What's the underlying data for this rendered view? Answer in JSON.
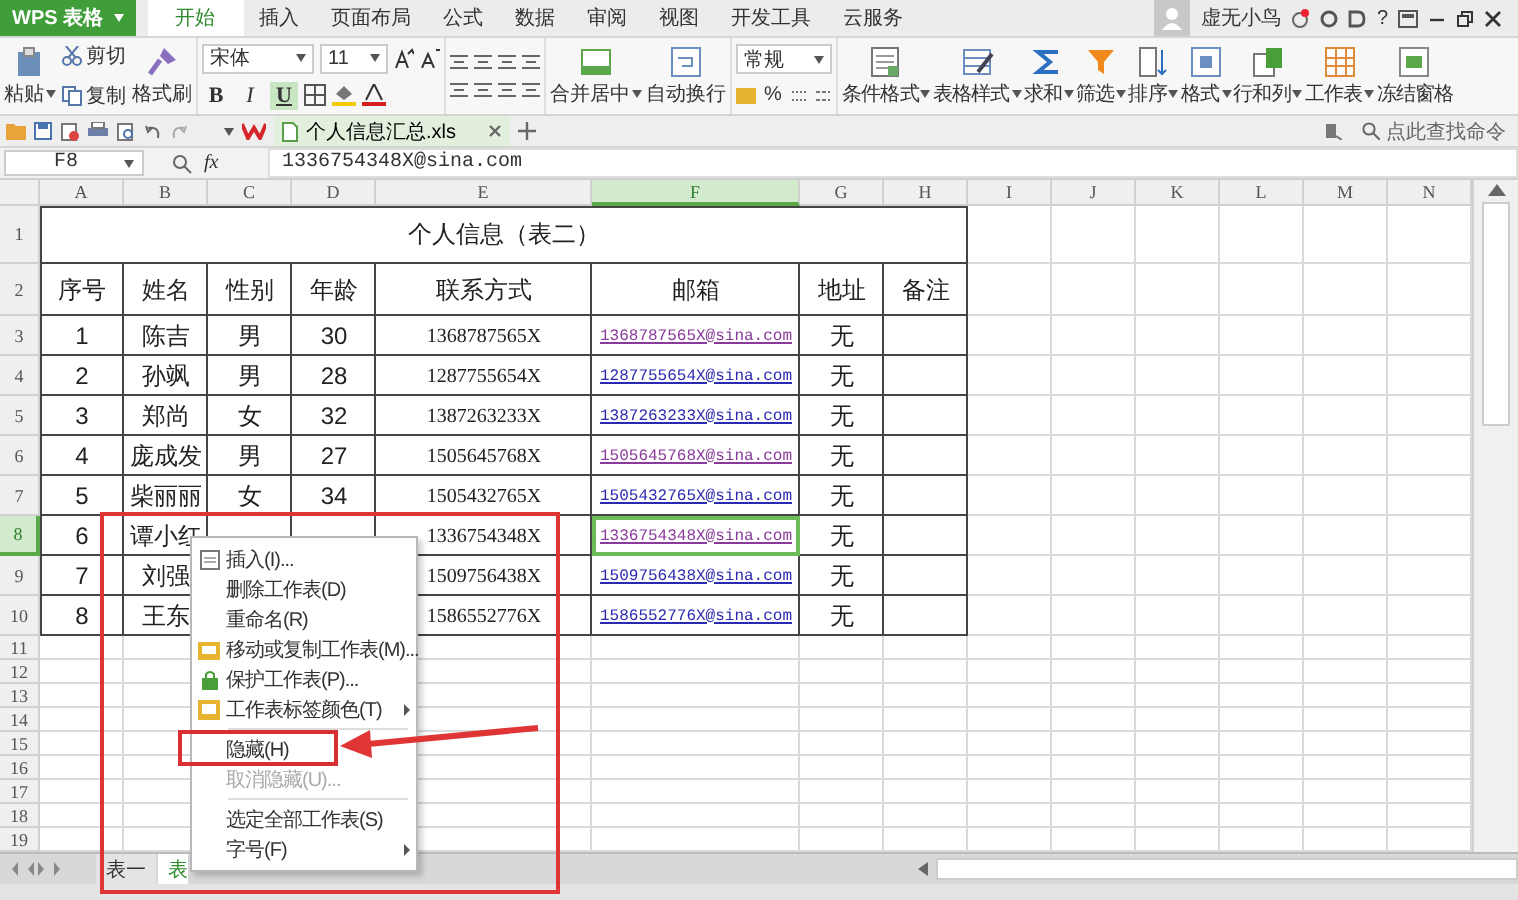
{
  "app_button": {
    "label": "WPS 表格"
  },
  "menu_tabs": [
    {
      "label": "开始",
      "selected": true
    },
    {
      "label": "插入",
      "selected": false
    },
    {
      "label": "页面布局",
      "selected": false
    },
    {
      "label": "公式",
      "selected": false
    },
    {
      "label": "数据",
      "selected": false
    },
    {
      "label": "审阅",
      "selected": false
    },
    {
      "label": "视图",
      "selected": false
    },
    {
      "label": "开发工具",
      "selected": false
    },
    {
      "label": "云服务",
      "selected": false
    }
  ],
  "account": {
    "user_name": "虚无小鸟",
    "help": "?"
  },
  "ribbon": {
    "paste": "粘贴",
    "cut": "剪切",
    "copy": "复制",
    "format_painter": "格式刷",
    "font_name": "宋体",
    "font_size": "11",
    "bold": "B",
    "italic": "I",
    "underline": "U",
    "underline_on": true,
    "merge": "合并居中",
    "wrap": "自动换行",
    "number_format": "常规",
    "percent": "%",
    "buttons": [
      {
        "label": "条件格式"
      },
      {
        "label": "表格样式"
      },
      {
        "label": "求和"
      },
      {
        "label": "筛选"
      },
      {
        "label": "排序"
      },
      {
        "label": "格式"
      },
      {
        "label": "行和列"
      },
      {
        "label": "工作表"
      },
      {
        "label": "冻结窗格"
      }
    ]
  },
  "document_tab": {
    "title": "个人信息汇总.xls"
  },
  "command_search": {
    "placeholder": "点此查找命令"
  },
  "formula_bar": {
    "cell": "F8",
    "fx": "fx",
    "value": "1336754348X@sina.com"
  },
  "sheet": {
    "columns": [
      {
        "label": "A",
        "selected": false
      },
      {
        "label": "B",
        "selected": false
      },
      {
        "label": "C",
        "selected": false
      },
      {
        "label": "D",
        "selected": false
      },
      {
        "label": "E",
        "selected": false
      },
      {
        "label": "F",
        "selected": true
      },
      {
        "label": "G",
        "selected": false
      },
      {
        "label": "H",
        "selected": false
      },
      {
        "label": "I",
        "selected": false
      },
      {
        "label": "J",
        "selected": false
      },
      {
        "label": "K",
        "selected": false
      },
      {
        "label": "L",
        "selected": false
      },
      {
        "label": "M",
        "selected": false
      },
      {
        "label": "N",
        "selected": false
      }
    ],
    "row_numbers": [
      {
        "label": "1",
        "selected": false
      },
      {
        "label": "2",
        "selected": false
      },
      {
        "label": "3",
        "selected": false
      },
      {
        "label": "4",
        "selected": false
      },
      {
        "label": "5",
        "selected": false
      },
      {
        "label": "6",
        "selected": false
      },
      {
        "label": "7",
        "selected": false
      },
      {
        "label": "8",
        "selected": true
      },
      {
        "label": "9",
        "selected": false
      },
      {
        "label": "10",
        "selected": false
      },
      {
        "label": "11",
        "selected": false
      },
      {
        "label": "12",
        "selected": false
      },
      {
        "label": "13",
        "selected": false
      },
      {
        "label": "14",
        "selected": false
      },
      {
        "label": "15",
        "selected": false
      },
      {
        "label": "16",
        "selected": false
      },
      {
        "label": "17",
        "selected": false
      },
      {
        "label": "18",
        "selected": false
      },
      {
        "label": "19",
        "selected": false
      }
    ],
    "title": "个人信息（表二）",
    "headers": [
      "序号",
      "姓名",
      "性别",
      "年龄",
      "联系方式",
      "邮箱",
      "地址",
      "备注"
    ],
    "rows": [
      {
        "no": "1",
        "name": "陈吉",
        "gender": "男",
        "age": "30",
        "phone": "1368787565X",
        "email": "1368787565X@sina.com",
        "visited": true,
        "address": "无"
      },
      {
        "no": "2",
        "name": "孙飒",
        "gender": "男",
        "age": "28",
        "phone": "1287755654X",
        "email": "1287755654X@sina.com",
        "visited": false,
        "address": "无"
      },
      {
        "no": "3",
        "name": "郑尚",
        "gender": "女",
        "age": "32",
        "phone": "1387263233X",
        "email": "1387263233X@sina.com",
        "visited": false,
        "address": "无"
      },
      {
        "no": "4",
        "name": "庞成发",
        "gender": "男",
        "age": "27",
        "phone": "1505645768X",
        "email": "1505645768X@sina.com",
        "visited": true,
        "address": "无"
      },
      {
        "no": "5",
        "name": "柴丽丽",
        "gender": "女",
        "age": "34",
        "phone": "1505432765X",
        "email": "1505432765X@sina.com",
        "visited": false,
        "address": "无"
      },
      {
        "no": "6",
        "name": "谭小红",
        "gender": null,
        "age": null,
        "phone": "1336754348X",
        "email": "1336754348X@sina.com",
        "visited": true,
        "address": "无"
      },
      {
        "no": "7",
        "name": "刘强",
        "gender": null,
        "age": null,
        "phone": "1509756438X",
        "email": "1509756438X@sina.com",
        "visited": false,
        "address": "无"
      },
      {
        "no": "8",
        "name": "王东",
        "gender": null,
        "age": null,
        "phone": "1586552776X",
        "email": "1586552776X@sina.com",
        "visited": false,
        "address": "无"
      }
    ]
  },
  "sheet_tabs": [
    {
      "label": "表一",
      "selected": false
    },
    {
      "label": "表",
      "selected": true
    }
  ],
  "context_menu": [
    {
      "kind": "item",
      "label": "插入(I)...",
      "submenu": false,
      "disabled": false
    },
    {
      "kind": "item",
      "label": "删除工作表(D)",
      "submenu": false,
      "disabled": false
    },
    {
      "kind": "item",
      "label": "重命名(R)",
      "submenu": false,
      "disabled": false
    },
    {
      "kind": "item",
      "label": "移动或复制工作表(M)...",
      "submenu": false,
      "disabled": false
    },
    {
      "kind": "item",
      "label": "保护工作表(P)...",
      "submenu": false,
      "disabled": false
    },
    {
      "kind": "item",
      "label": "工作表标签颜色(T)",
      "submenu": true,
      "disabled": false
    },
    {
      "kind": "separator"
    },
    {
      "kind": "item",
      "label": "隐藏(H)",
      "submenu": false,
      "disabled": false
    },
    {
      "kind": "item",
      "label": "取消隐藏(U)...",
      "submenu": false,
      "disabled": true
    },
    {
      "kind": "separator"
    },
    {
      "kind": "item",
      "label": "选定全部工作表(S)",
      "submenu": false,
      "disabled": false
    },
    {
      "kind": "item",
      "label": "字号(F)",
      "submenu": true,
      "disabled": false
    }
  ],
  "annotations": [
    {
      "kind": "frame"
    },
    {
      "kind": "highlight"
    },
    {
      "kind": "arrow"
    }
  ]
}
